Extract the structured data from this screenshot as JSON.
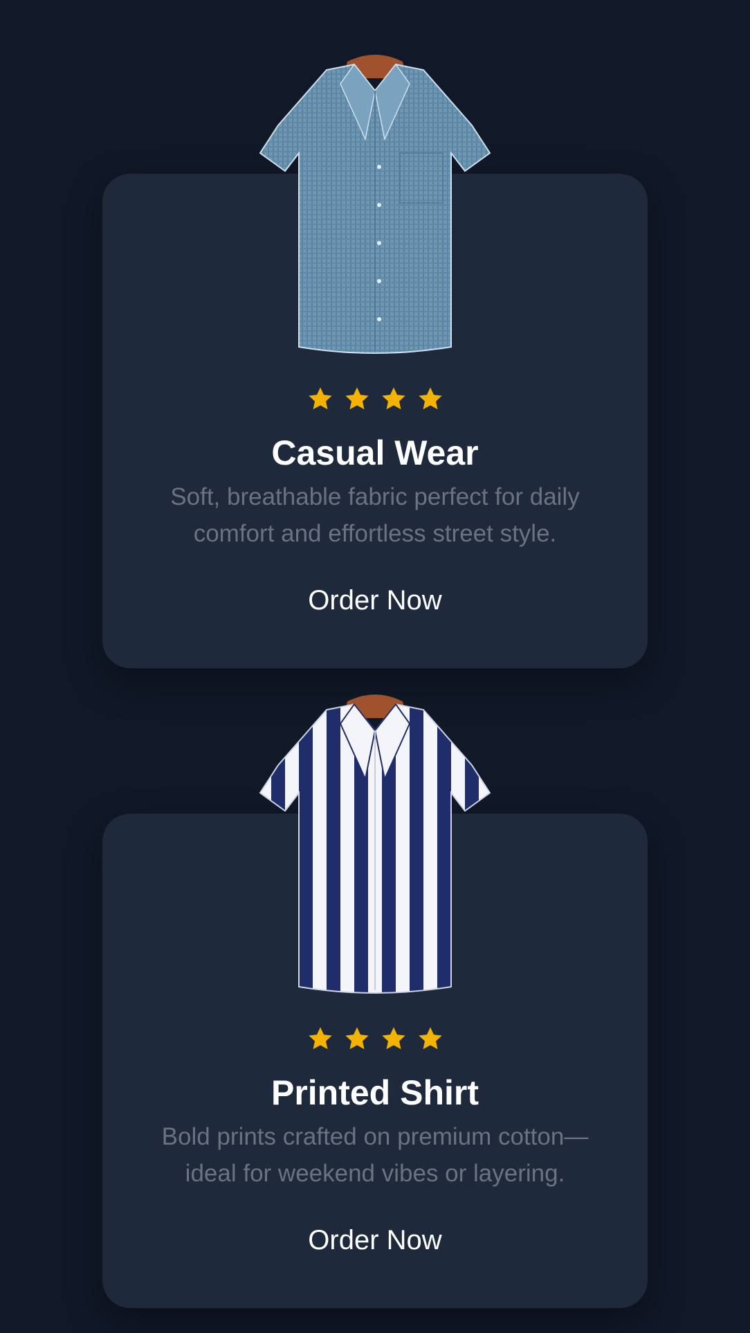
{
  "products": [
    {
      "image_icon": "blue-textured-shirt-image",
      "rating": 4,
      "title": "Casual Wear",
      "description": "Soft, breathable fabric perfect for daily comfort and effortless street style.",
      "button_label": "Order Now"
    },
    {
      "image_icon": "navy-white-striped-shirt-image",
      "rating": 4,
      "title": "Printed Shirt",
      "description": "Bold prints crafted on premium cotton—ideal for weekend vibes or layering.",
      "button_label": "Order Now"
    }
  ],
  "colors": {
    "background": "#111827",
    "card": "#1e293b",
    "star": "#f5b301",
    "title": "#ffffff",
    "description": "#6b7280"
  }
}
